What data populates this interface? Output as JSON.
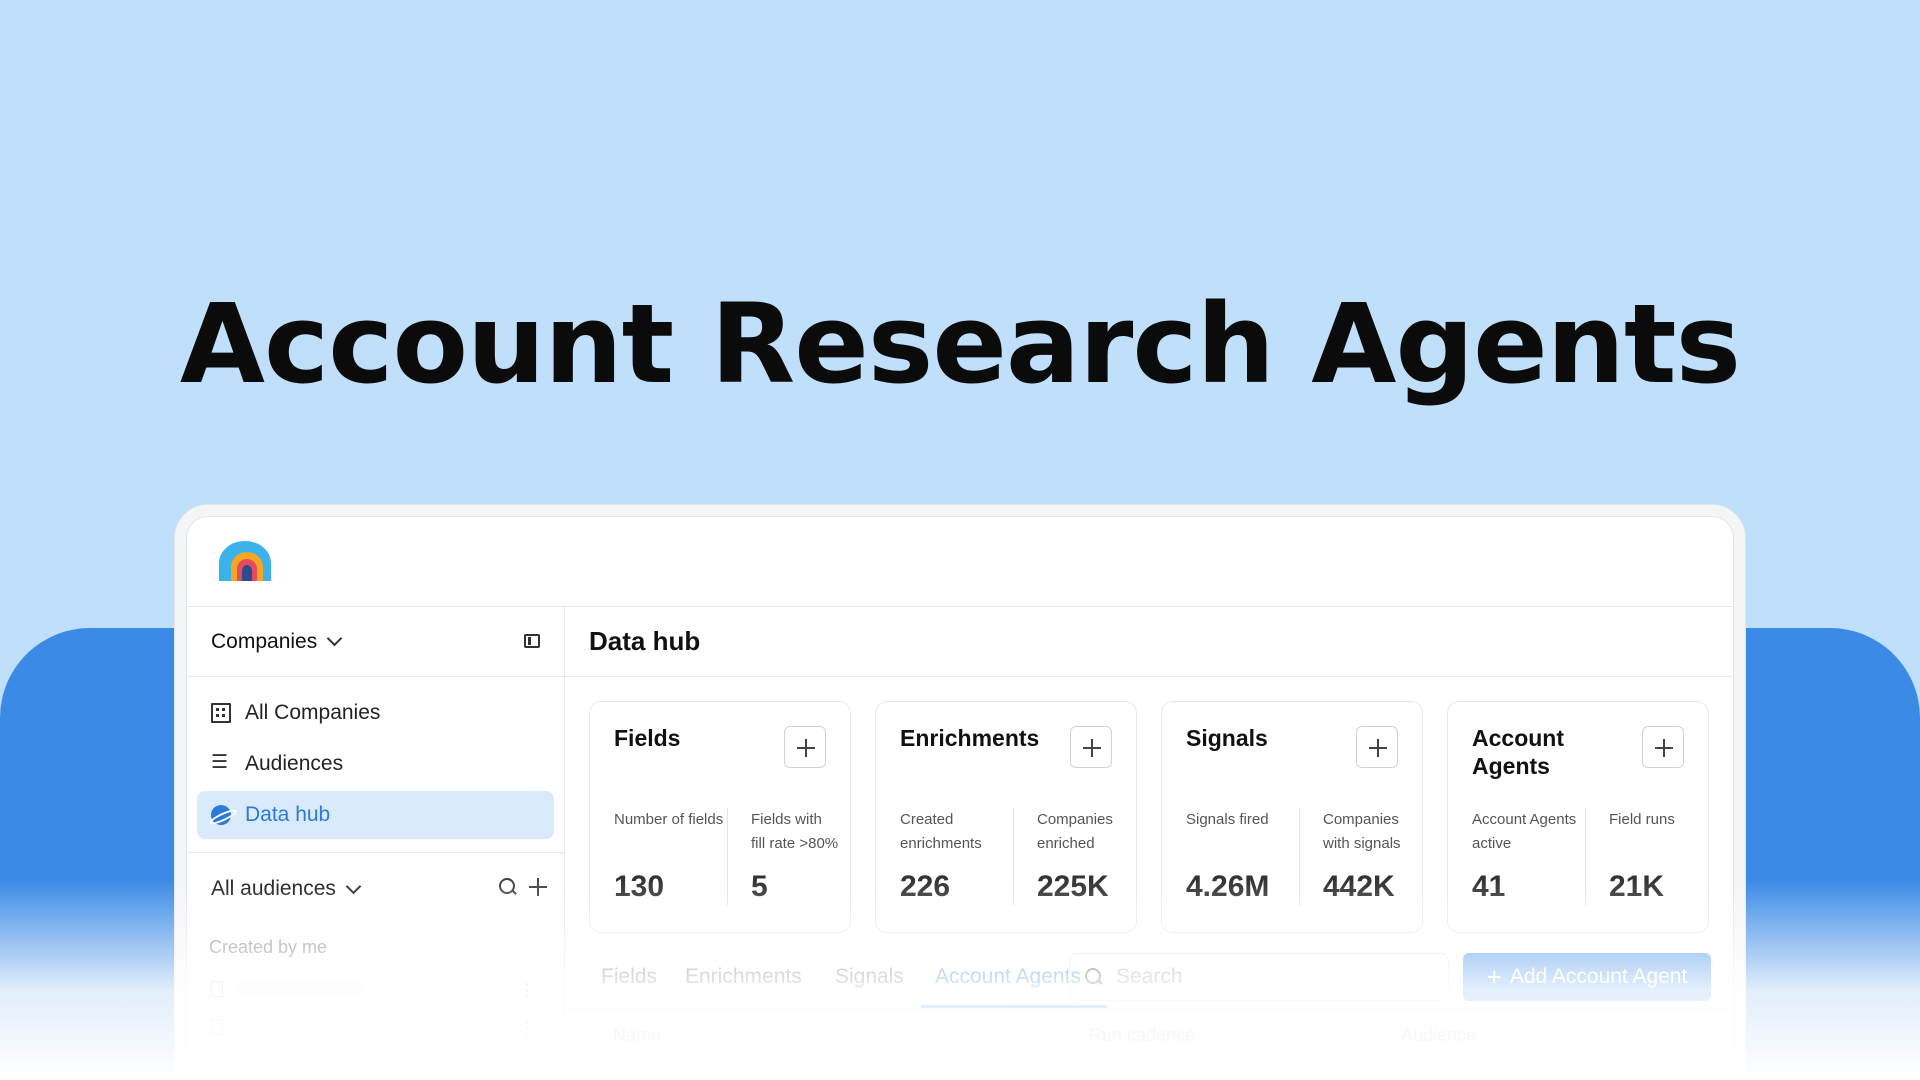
{
  "hero": {
    "title": "Account Research Agents"
  },
  "colors": {
    "accent": "#2a7ad6",
    "background": "#bfdffa",
    "band": "#3b8be6"
  },
  "sidebar": {
    "section_selector": "Companies",
    "nav": [
      {
        "label": "All Companies",
        "icon": "building-icon"
      },
      {
        "label": "Audiences",
        "icon": "list-icon"
      },
      {
        "label": "Data hub",
        "icon": "planet-icon",
        "active": true
      }
    ],
    "audiences_selector": "All audiences",
    "created_by_me": "Created by me"
  },
  "main": {
    "title": "Data hub",
    "cards": [
      {
        "title": "Fields",
        "stats": [
          {
            "label": "Number of fields",
            "value": "130"
          },
          {
            "label": "Fields with fill rate >80%",
            "value": "5"
          }
        ]
      },
      {
        "title": "Enrichments",
        "stats": [
          {
            "label": "Created enrichments",
            "value": "226"
          },
          {
            "label": "Companies enriched",
            "value": "225K"
          }
        ]
      },
      {
        "title": "Signals",
        "stats": [
          {
            "label": "Signals fired",
            "value": "4.26M"
          },
          {
            "label": "Companies with signals",
            "value": "442K"
          }
        ]
      },
      {
        "title": "Account Agents",
        "stats": [
          {
            "label": "Account Agents active",
            "value": "41"
          },
          {
            "label": "Field runs",
            "value": "21K"
          }
        ]
      }
    ],
    "tabs": [
      "Fields",
      "Enrichments",
      "Signals",
      "Account Agents"
    ],
    "active_tab": "Account Agents",
    "search": {
      "placeholder": "Search"
    },
    "add_button": "Add Account Agent",
    "table_columns": [
      "Name",
      "Run cadence",
      "Audience"
    ]
  }
}
